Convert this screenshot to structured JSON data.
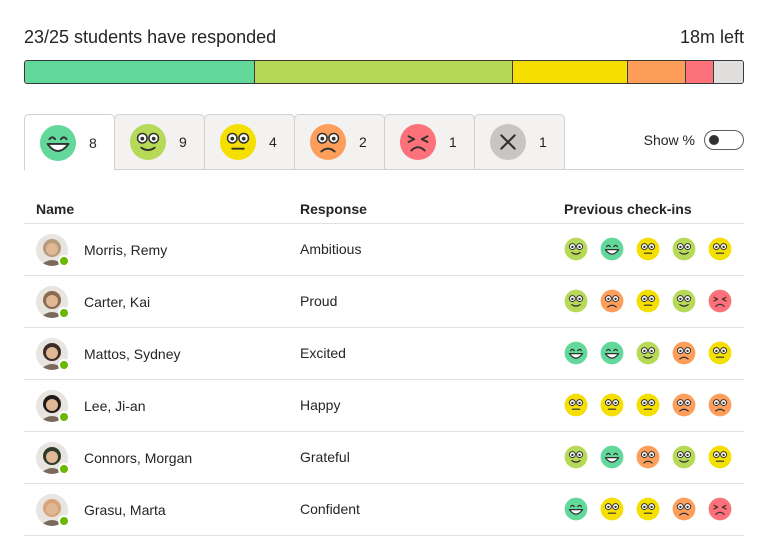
{
  "header": {
    "responded": "23/25 students have responded",
    "time_left": "18m left"
  },
  "progress": {
    "segments": [
      {
        "emotion": "great",
        "color": "#63d89b",
        "count": 8
      },
      {
        "emotion": "good",
        "color": "#b6d957",
        "count": 9
      },
      {
        "emotion": "okay",
        "color": "#f4df00",
        "count": 4
      },
      {
        "emotion": "sad",
        "color": "#fd9e5b",
        "count": 2
      },
      {
        "emotion": "upset",
        "color": "#fd717a",
        "count": 1
      },
      {
        "emotion": "no-response",
        "color": "#e1dfdd",
        "count": 1
      }
    ]
  },
  "tabs": [
    {
      "emotion": "great",
      "count": "8",
      "active": true
    },
    {
      "emotion": "good",
      "count": "9",
      "active": false
    },
    {
      "emotion": "okay",
      "count": "4",
      "active": false
    },
    {
      "emotion": "sad",
      "count": "2",
      "active": false
    },
    {
      "emotion": "upset",
      "count": "1",
      "active": false
    },
    {
      "emotion": "no-response",
      "count": "1",
      "active": false
    }
  ],
  "show_percent": {
    "label": "Show %",
    "on": false
  },
  "table": {
    "headers": {
      "name": "Name",
      "response": "Response",
      "previous": "Previous check-ins"
    },
    "rows": [
      {
        "name": "Morris, Remy",
        "response": "Ambitious",
        "history": [
          "good",
          "great",
          "okay",
          "good",
          "okay"
        ]
      },
      {
        "name": "Carter, Kai",
        "response": "Proud",
        "history": [
          "good",
          "sad",
          "okay",
          "good",
          "upset"
        ]
      },
      {
        "name": "Mattos, Sydney",
        "response": "Excited",
        "history": [
          "great",
          "great",
          "good",
          "sad",
          "okay"
        ]
      },
      {
        "name": "Lee, Ji-an",
        "response": "Happy",
        "history": [
          "okay",
          "okay",
          "okay",
          "sad",
          "sad"
        ]
      },
      {
        "name": "Connors, Morgan",
        "response": "Grateful",
        "history": [
          "good",
          "great",
          "sad",
          "good",
          "okay"
        ]
      },
      {
        "name": "Grasu, Marta",
        "response": "Confident",
        "history": [
          "great",
          "okay",
          "okay",
          "sad",
          "upset"
        ]
      }
    ]
  },
  "colors": {
    "great": "#63d89b",
    "good": "#b6d957",
    "okay": "#f4df00",
    "sad": "#fd9e5b",
    "upset": "#fd717a",
    "no-response": "#c8c6c4"
  }
}
